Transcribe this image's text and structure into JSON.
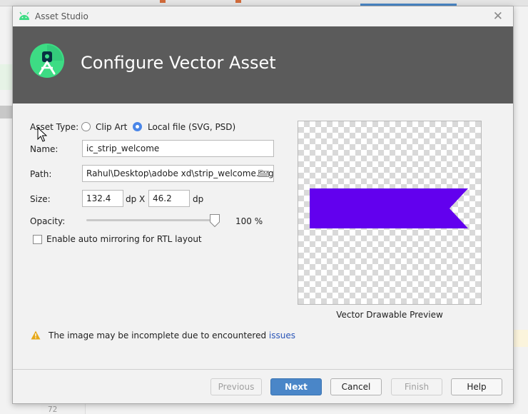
{
  "ide": {
    "line_number": "72",
    "paren": ")"
  },
  "window": {
    "title": "Asset Studio",
    "close_glyph": "✕"
  },
  "banner": {
    "heading": "Configure Vector Asset"
  },
  "form": {
    "asset_type_label": "Asset Type:",
    "asset_type_options": [
      {
        "label": "Clip Art",
        "selected": false
      },
      {
        "label": "Local file (SVG, PSD)",
        "selected": true
      }
    ],
    "name_label": "Name:",
    "name_value": "ic_strip_welcome",
    "path_label": "Path:",
    "path_value": "Rahul\\Desktop\\adobe xd\\strip_welcome.svg",
    "size_label": "Size:",
    "width_value": "132.4",
    "height_value": "46.2",
    "unit_dp": "dp",
    "size_separator": "X",
    "opacity_label": "Opacity:",
    "opacity_percent": 100,
    "opacity_text": "100 %",
    "mirror_label": "Enable auto mirroring for RTL layout",
    "mirror_checked": false
  },
  "preview": {
    "caption": "Vector Drawable Preview",
    "shape_color": "#6200ee"
  },
  "warning": {
    "text": "The image may be incomplete due to encountered ",
    "link": "issues"
  },
  "buttons": {
    "previous": "Previous",
    "next": "Next",
    "cancel": "Cancel",
    "finish": "Finish",
    "help": "Help"
  },
  "colors": {
    "banner_bg": "#5b5b5b",
    "primary_button": "#4a86c8",
    "android_green": "#3ddc84",
    "link": "#2a55b8"
  },
  "icons": [
    "android-icon",
    "close-icon",
    "android-studio-logo",
    "folder-icon",
    "warning-icon",
    "mouse-cursor-icon"
  ]
}
